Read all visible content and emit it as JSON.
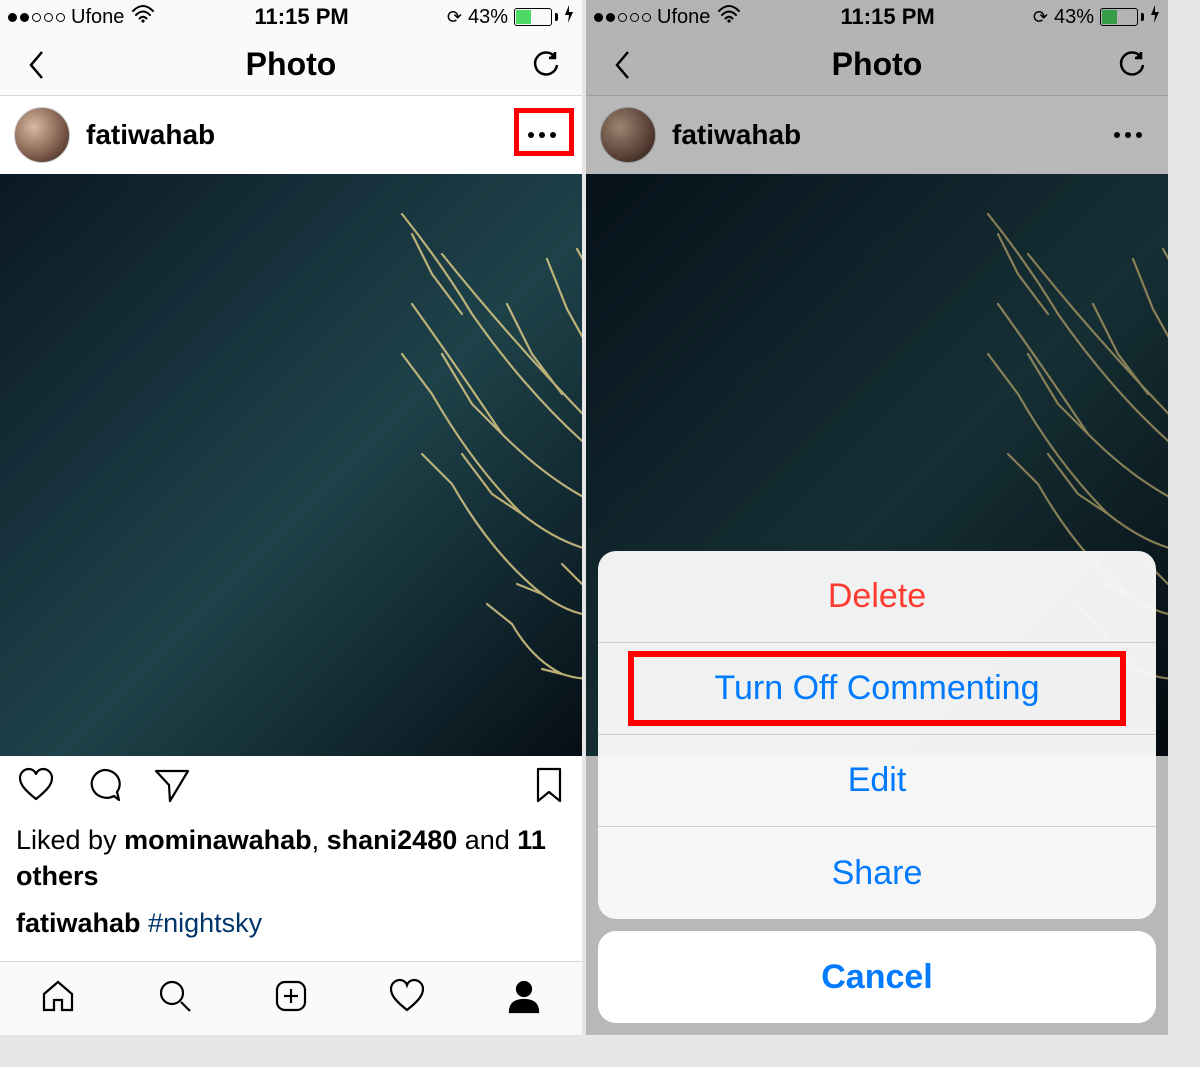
{
  "statusbar": {
    "carrier": "Ufone",
    "time": "11:15 PM",
    "batteryPercent": "43%",
    "signalFilled": 2,
    "signalTotal": 5
  },
  "navbar": {
    "title": "Photo"
  },
  "post": {
    "username": "fatiwahab"
  },
  "likes": {
    "prefix": "Liked by ",
    "user1": "mominawahab",
    "sep1": ", ",
    "user2": "shani2480",
    "sep2": " and ",
    "others": "11 others"
  },
  "caption": {
    "author": "fatiwahab",
    "hashtag": "#nightsky"
  },
  "actionSheet": {
    "delete": "Delete",
    "turnOffCommenting": "Turn Off Commenting",
    "edit": "Edit",
    "share": "Share",
    "cancel": "Cancel"
  }
}
